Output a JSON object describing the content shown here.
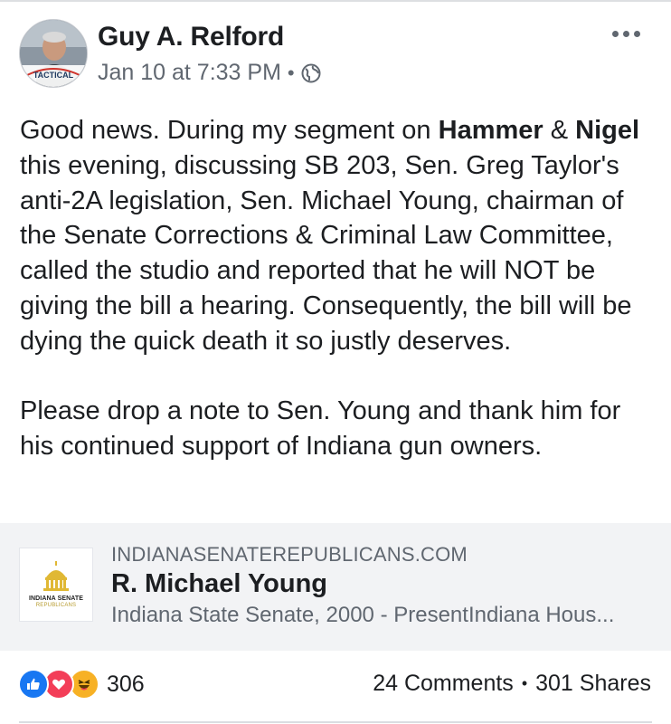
{
  "post": {
    "author": "Guy A. Relford",
    "timestamp": "Jan 10 at 7:33 PM",
    "meta_separator": "•",
    "privacy_icon": "globe-icon",
    "more_icon": "more-horizontal-icon",
    "avatar_caption": "TACTICAL",
    "body": {
      "p1_intro": "Good news.  During my segment on ",
      "p1_bold1": "Hammer",
      "p1_amp": " & ",
      "p1_bold2": "Nigel",
      "p1_rest": " this evening, discussing SB 203, Sen. Greg Taylor's anti-2A legislation, Sen. Michael Young, chairman of the Senate Corrections & Criminal Law Committee, called the studio and reported that he will NOT be giving the bill a hearing. Consequently, the bill will be dying the quick death it so justly deserves.",
      "p2": "Please drop a note to Sen. Young and thank him for his continued support of Indiana gun owners."
    }
  },
  "link_preview": {
    "domain": "INDIANASENATEREPUBLICANS.COM",
    "title": "R. Michael Young",
    "description": "Indiana State Senate, 2000 - PresentIndiana Hous...",
    "thumb_line1": "INDIANA SENATE",
    "thumb_line2": "REPUBLICANS"
  },
  "footer": {
    "reaction_icons": [
      "like-icon",
      "love-icon",
      "haha-icon"
    ],
    "reaction_count": "306",
    "comments": "24 Comments",
    "separator": "•",
    "shares": "301 Shares"
  },
  "colors": {
    "text": "#1c1e21",
    "secondary": "#606770",
    "link_bg": "#f2f3f5",
    "like": "#1877f2",
    "love": "#f33e58",
    "haha": "#f7b125"
  }
}
